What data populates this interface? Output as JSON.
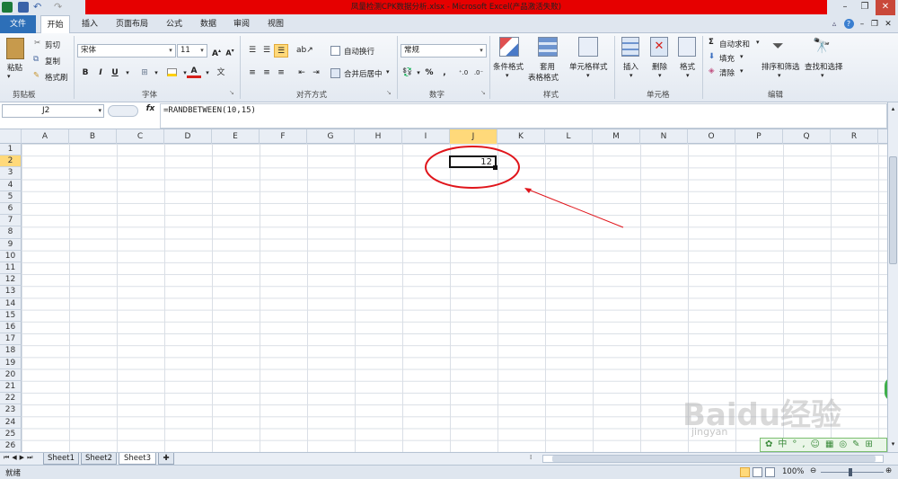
{
  "titlebar": {
    "title": "凤量检测CPK数据分析.xlsx  -  Microsoft Excel(产品激活失败)"
  },
  "tabs": {
    "file": "文件",
    "items": [
      "开始",
      "插入",
      "页面布局",
      "公式",
      "数据",
      "审阅",
      "视图"
    ]
  },
  "ribbon": {
    "clipboard": {
      "paste": "粘贴",
      "cut": "剪切",
      "copy": "复制",
      "format_painter": "格式刷",
      "label": "剪贴板"
    },
    "font": {
      "name": "宋体",
      "size": "11",
      "bold": "B",
      "italic": "I",
      "underline": "U",
      "label": "字体"
    },
    "alignment": {
      "wrap": "自动换行",
      "merge": "合并后居中",
      "label": "对齐方式"
    },
    "number": {
      "format": "常规",
      "percent": "%",
      "comma": ",",
      "label": "数字"
    },
    "styles": {
      "conditional": "条件格式",
      "table_line1": "套用",
      "table_line2": "表格格式",
      "cell_styles": "单元格样式",
      "label": "样式"
    },
    "cells": {
      "insert": "插入",
      "delete": "删除",
      "format": "格式",
      "label": "单元格"
    },
    "editing": {
      "autosum": "自动求和",
      "fill": "填充",
      "clear": "清除",
      "sort": "排序和筛选",
      "find": "查找和选择",
      "label": "编辑"
    }
  },
  "formula_bar": {
    "name_box": "J2",
    "fx": "fx",
    "formula": "=RANDBETWEEN(10,15)"
  },
  "grid": {
    "columns": [
      "A",
      "B",
      "C",
      "D",
      "E",
      "F",
      "G",
      "H",
      "I",
      "J",
      "K",
      "L",
      "M",
      "N",
      "O",
      "P",
      "Q",
      "R"
    ],
    "rows": [
      "1",
      "2",
      "3",
      "4",
      "5",
      "6",
      "7",
      "8",
      "9",
      "10",
      "11",
      "12",
      "13",
      "14",
      "15",
      "16",
      "17",
      "18",
      "19",
      "20",
      "21",
      "22",
      "23",
      "24",
      "25",
      "26"
    ],
    "active_cell_value": "12"
  },
  "sheets": [
    "Sheet1",
    "Sheet2",
    "Sheet3"
  ],
  "status": {
    "mode": "就绪",
    "zoom": "100%"
  },
  "watermark": {
    "text": "Baidu经验",
    "subtext": "jingyan"
  },
  "colors": {
    "title_red": "#e60000",
    "file_tab": "#2d6fb8",
    "annotation_red": "#e0151b"
  }
}
